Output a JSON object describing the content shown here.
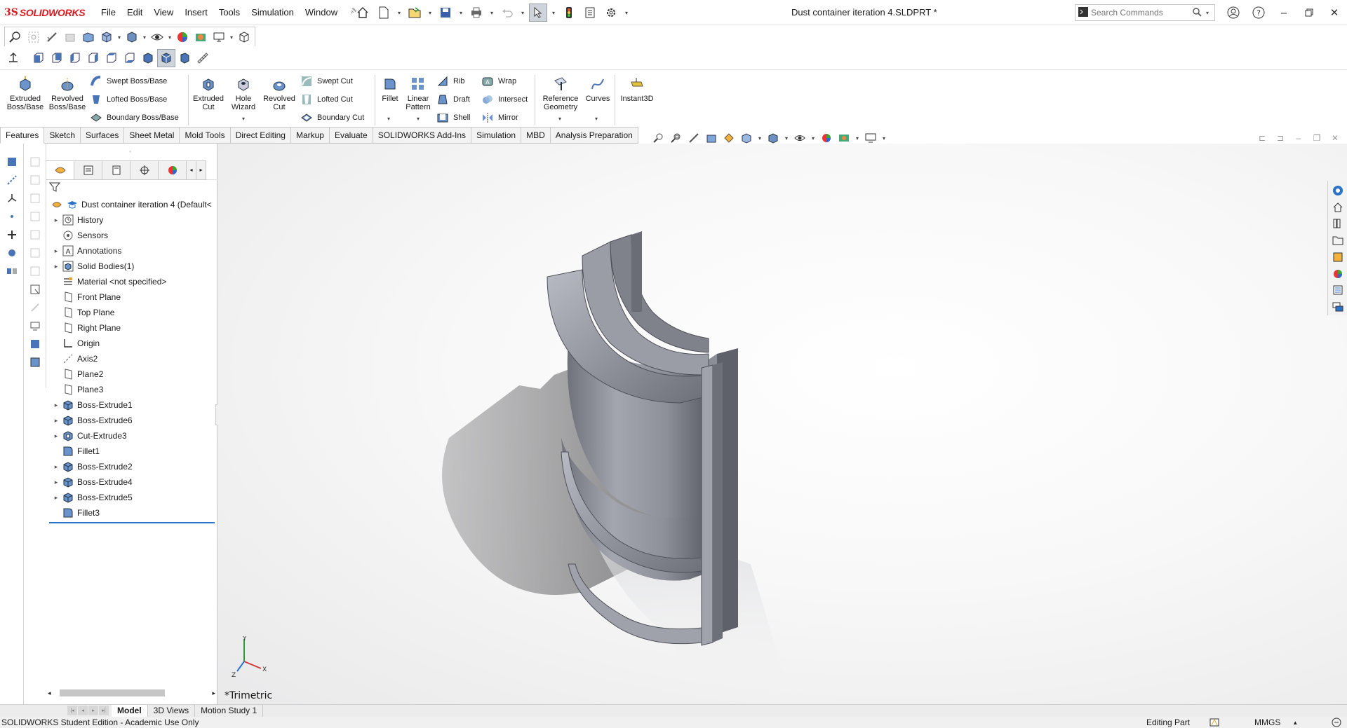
{
  "app": {
    "brand": "SOLIDWORKS",
    "brand_prefix": "3S",
    "document_title": "Dust container iteration 4.SLDPRT *"
  },
  "menu": [
    "File",
    "Edit",
    "View",
    "Insert",
    "Tools",
    "Simulation",
    "Window"
  ],
  "search": {
    "placeholder": "Search Commands"
  },
  "command_manager": {
    "extruded_boss": "Extruded\nBoss/Base",
    "revolved_boss": "Revolved\nBoss/Base",
    "swept_boss": "Swept Boss/Base",
    "lofted_boss": "Lofted Boss/Base",
    "boundary_boss": "Boundary Boss/Base",
    "extruded_cut": "Extruded\nCut",
    "hole_wizard": "Hole\nWizard",
    "revolved_cut": "Revolved\nCut",
    "swept_cut": "Swept Cut",
    "lofted_cut": "Lofted Cut",
    "boundary_cut": "Boundary Cut",
    "fillet": "Fillet",
    "linear_pattern": "Linear\nPattern",
    "rib": "Rib",
    "draft": "Draft",
    "shell": "Shell",
    "wrap": "Wrap",
    "intersect": "Intersect",
    "mirror": "Mirror",
    "reference_geometry": "Reference\nGeometry",
    "curves": "Curves",
    "instant3d": "Instant3D"
  },
  "tabs": [
    "Features",
    "Sketch",
    "Surfaces",
    "Sheet Metal",
    "Mold Tools",
    "Direct Editing",
    "Markup",
    "Evaluate",
    "SOLIDWORKS Add-Ins",
    "Simulation",
    "MBD",
    "Analysis Preparation"
  ],
  "active_tab": "Features",
  "feature_tree": {
    "root": "Dust container iteration 4  (Default<",
    "items": [
      {
        "label": "History",
        "expandable": true,
        "icon": "history-icon"
      },
      {
        "label": "Sensors",
        "expandable": false,
        "icon": "sensors-icon"
      },
      {
        "label": "Annotations",
        "expandable": true,
        "icon": "annotations-icon"
      },
      {
        "label": "Solid Bodies(1)",
        "expandable": true,
        "icon": "solid-bodies-icon"
      },
      {
        "label": "Material <not specified>",
        "expandable": false,
        "icon": "material-icon"
      },
      {
        "label": "Front Plane",
        "expandable": false,
        "icon": "plane-icon"
      },
      {
        "label": "Top Plane",
        "expandable": false,
        "icon": "plane-icon"
      },
      {
        "label": "Right Plane",
        "expandable": false,
        "icon": "plane-icon"
      },
      {
        "label": "Origin",
        "expandable": false,
        "icon": "origin-icon"
      },
      {
        "label": "Axis2",
        "expandable": false,
        "icon": "axis-icon"
      },
      {
        "label": "Plane2",
        "expandable": false,
        "icon": "plane-icon"
      },
      {
        "label": "Plane3",
        "expandable": false,
        "icon": "plane-icon"
      },
      {
        "label": "Boss-Extrude1",
        "expandable": true,
        "icon": "extrude-icon"
      },
      {
        "label": "Boss-Extrude6",
        "expandable": true,
        "icon": "extrude-icon"
      },
      {
        "label": "Cut-Extrude3",
        "expandable": true,
        "icon": "cut-extrude-icon"
      },
      {
        "label": "Fillet1",
        "expandable": false,
        "icon": "fillet-icon"
      },
      {
        "label": "Boss-Extrude2",
        "expandable": true,
        "icon": "extrude-icon"
      },
      {
        "label": "Boss-Extrude4",
        "expandable": true,
        "icon": "extrude-icon"
      },
      {
        "label": "Boss-Extrude5",
        "expandable": true,
        "icon": "extrude-icon"
      },
      {
        "label": "Fillet3",
        "expandable": false,
        "icon": "fillet-icon"
      }
    ]
  },
  "viewport": {
    "view_orientation": "*Trimetric",
    "triad": {
      "x": "X",
      "y": "Y",
      "z": "Z"
    }
  },
  "bottom_tabs": [
    "Model",
    "3D Views",
    "Motion Study 1"
  ],
  "active_bottom_tab": "Model",
  "status": {
    "edition": "SOLIDWORKS Student Edition - Academic Use Only",
    "mode": "Editing Part",
    "units": "MMGS"
  },
  "colors": {
    "brand_red": "#d71920",
    "accent_blue": "#2b73c8",
    "model_gray": "#8c8f98"
  }
}
